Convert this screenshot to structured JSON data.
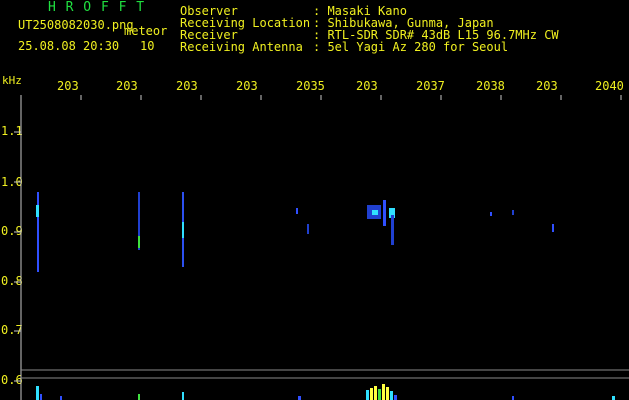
{
  "header": {
    "title": "H R O F F T",
    "filename": "UT2508082030.png",
    "mode": "meteor",
    "datetime": "25.08.08 20:30",
    "interval": "10",
    "info": [
      {
        "label": "Observer",
        "value": ": Masaki Kano"
      },
      {
        "label": "Receiving Location",
        "value": ": Shibukawa, Gunma, Japan"
      },
      {
        "label": "Receiver",
        "value": ": RTL-SDR SDR# 43dB L15 96.7MHz CW"
      },
      {
        "label": "Receiving Antenna",
        "value": ": 5el Yagi Az 280 for Seoul"
      }
    ]
  },
  "axes": {
    "y_unit": "kHz",
    "y_ticks": [
      "1.1",
      "1.0",
      "0.9",
      "0.8",
      "0.7",
      "0.6"
    ],
    "x_ticks": [
      "203",
      "203",
      "203",
      "203",
      "2035",
      "203",
      "2037",
      "2038",
      "203",
      "2040"
    ]
  },
  "colors": {
    "text": "#f0f020",
    "title": "#20e040",
    "signal_blue": "#3050ff",
    "signal_cyan": "#30e0ff",
    "signal_yellow": "#ffff40",
    "axis": "#c8c8c8"
  }
}
